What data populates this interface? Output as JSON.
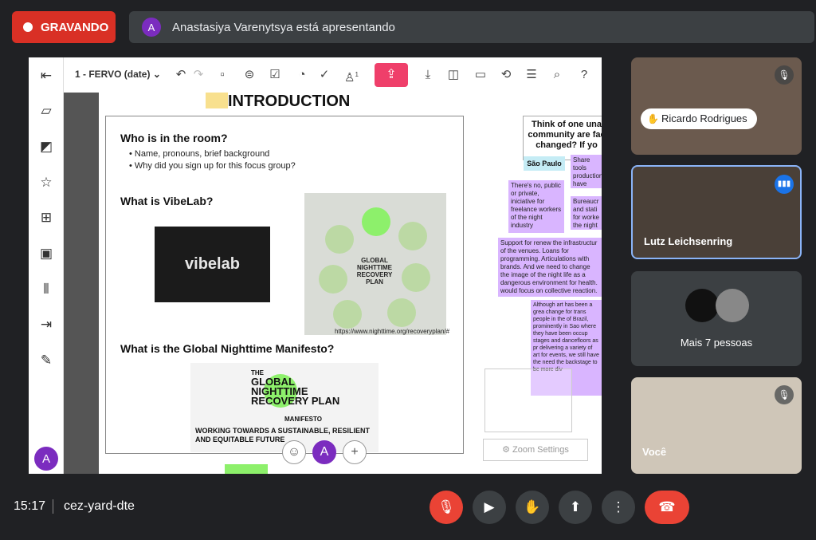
{
  "recording": {
    "label": "GRAVANDO"
  },
  "presenter": {
    "initial": "A",
    "text": "Anastasiya Varenytsya está apresentando"
  },
  "board": {
    "title": "1 - FERVO (date)",
    "dropdown_icon": "chevron-down-icon",
    "user_count": "1",
    "heading": "INTRODUCTION",
    "sections": [
      {
        "title": "Who is in the room?",
        "bullets": [
          "Name, pronouns, brief background",
          "Why did you sign up for this focus group?"
        ]
      },
      {
        "title": "What is VibeLab?"
      },
      {
        "title": "What is the Global Nighttime Manifesto?"
      }
    ],
    "vibelab_logo_text": "vibelab",
    "recovery_plan": {
      "center": "GLOBAL NIGHTTIME RECOVERY PLAN",
      "url": "https://www.nighttime.org/recoveryplan/#"
    },
    "manifesto": {
      "the": "THE",
      "title": "GLOBAL NIGHTTIME RECOVERY PLAN",
      "manifesto": "MANIFESTO",
      "tagline": "WORKING TOWARDS A SUSTAINABLE, RESILIENT AND EQUITABLE FUTURE"
    },
    "question": "Think of one una community are fac changed? If yo",
    "sao_paulo": "São Paulo",
    "stickies": [
      "There's no, public or private, iniciative for freelance workers of the night industry",
      "Share tools production have equit night live sc",
      "Bureaucr and stati for worke the night",
      "Support for renew the infrastructur of the venues. Loans for programming. Articulations with brands. And we need to change the image of the night life as a dangerous environment for health. would focus on collective reaction.",
      "Although art has been a grea change for trans people in the of Brazil, prominently in Sao where they have been occup stages and dancefloors as pr delivering a variety of art for events, we still have the need the backstage to be more div"
    ],
    "zoom_settings": "Zoom Settings",
    "user_avatar": "A"
  },
  "participants": [
    {
      "name": "Ricardo Rodrigues",
      "hand_raised": true,
      "muted": true
    },
    {
      "name": "Lutz Leichsenring",
      "speaking": true
    },
    {
      "name": "Mais 7 pessoas"
    },
    {
      "name": "Você",
      "muted": true
    }
  ],
  "footer": {
    "time": "15:17",
    "meeting_code": "cez-yard-dte"
  },
  "colors": {
    "recording": "#d93025",
    "accent": "#7b2cbf",
    "share": "#ef3f6a",
    "sticky": "#d9b5ff",
    "active_border": "#8ab4f8",
    "hangup": "#ea4335"
  }
}
